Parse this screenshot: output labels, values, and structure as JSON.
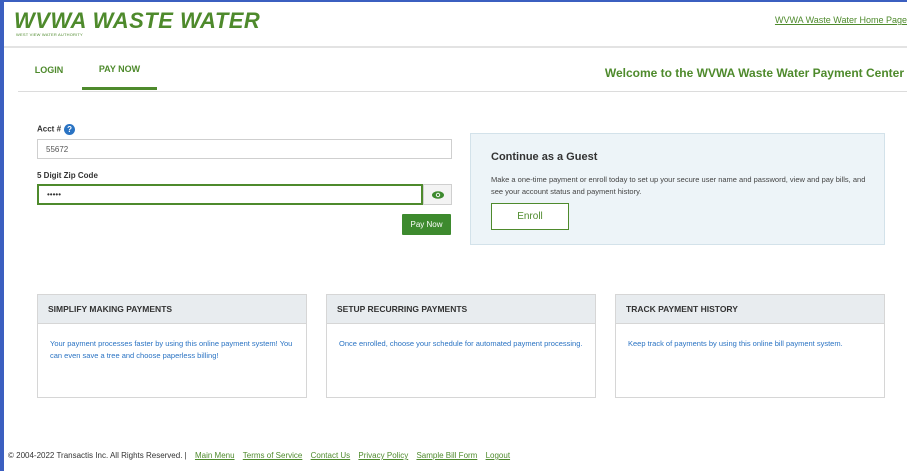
{
  "header": {
    "logo_text": "WVWA WASTE WATER",
    "logo_subtext": "WEST VIEW WATER AUTHORITY",
    "home_link": "WVWA Waste Water Home Page"
  },
  "nav": {
    "tabs": [
      {
        "label": "LOGIN"
      },
      {
        "label": "PAY NOW"
      }
    ],
    "welcome": "Welcome to the WVWA Waste Water Payment Center"
  },
  "form": {
    "acct_label": "Acct #",
    "acct_value": "55672",
    "zip_label": "5 Digit Zip Code",
    "zip_value": "•••••",
    "pay_button": "Pay Now"
  },
  "guest": {
    "title": "Continue as a Guest",
    "text": "Make a one-time payment or enroll today to set up your secure user name and password, view and pay bills, and see your account status and payment history.",
    "enroll_button": "Enroll"
  },
  "cards": [
    {
      "title": "SIMPLIFY MAKING PAYMENTS",
      "text": "Your payment processes faster by using this online payment system! You can even save a tree and choose paperless billing!"
    },
    {
      "title": "SETUP RECURRING PAYMENTS",
      "text": "Once enrolled, choose your schedule for automated payment processing."
    },
    {
      "title": "TRACK PAYMENT HISTORY",
      "text": "Keep track of payments by using this online bill payment system."
    }
  ],
  "footer": {
    "copyright": "© 2004-2022 Transactis Inc. All Rights Reserved. |",
    "links": [
      "Main Menu",
      "Terms of Service",
      "Contact Us",
      "Privacy Policy",
      "Sample Bill Form",
      "Logout"
    ]
  },
  "colors": {
    "brand_green": "#4e8a2c",
    "button_green": "#3d8a2e",
    "link_blue": "#2a73c3",
    "guest_bg": "#edf4f8"
  }
}
